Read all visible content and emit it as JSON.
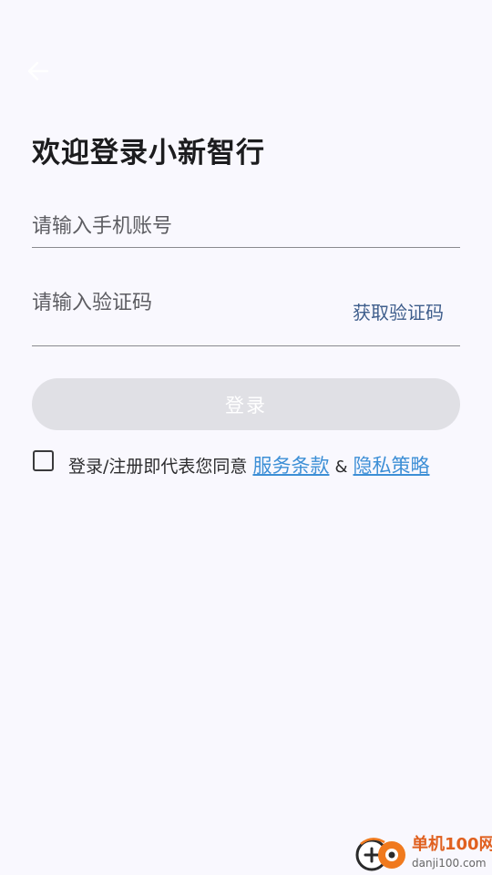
{
  "header": {
    "back_icon": "arrow-left-icon"
  },
  "title": "欢迎登录小新智行",
  "phone": {
    "placeholder": "请输入手机账号",
    "value": ""
  },
  "code": {
    "placeholder": "请输入验证码",
    "value": "",
    "get_code_label": "获取验证码"
  },
  "login_button": {
    "label": "登录",
    "enabled": false
  },
  "agreement": {
    "checked": false,
    "prefix": "登录/注册即代表您同意",
    "terms_link": "服务条款",
    "separator": "&",
    "privacy_link": "隐私策略"
  },
  "watermark": {
    "title": "单机100网",
    "subtitle": "danji100.com"
  },
  "colors": {
    "background": "#f9f8fe",
    "link": "#3d8fd6",
    "get_code": "#3f5e8c",
    "button_disabled": "#e0e0e5",
    "watermark_accent": "#e0601f"
  }
}
